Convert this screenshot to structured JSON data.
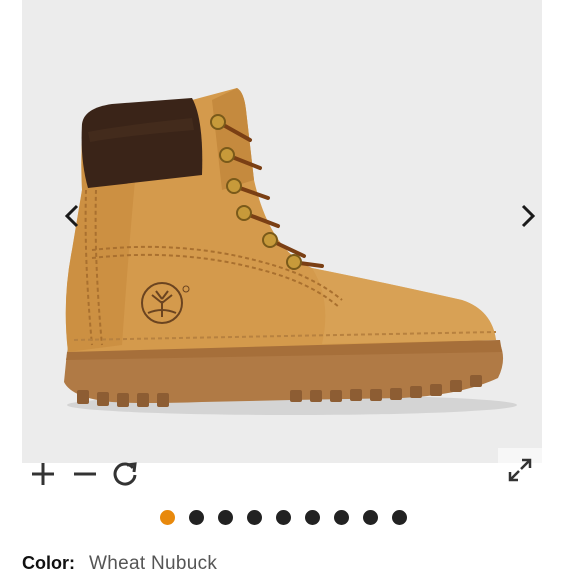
{
  "gallery": {
    "image_alt": "6-Inch Premium waterproof boot in Wheat Nubuck",
    "prev_icon": "chevron-left-icon",
    "next_icon": "chevron-right-icon",
    "active_index": 0,
    "count": 9
  },
  "toolbar": {
    "zoom_in_icon": "plus-icon",
    "zoom_out_icon": "minus-icon",
    "reset_icon": "refresh-icon",
    "fullscreen_icon": "expand-icon"
  },
  "color": {
    "label": "Color:",
    "value": "Wheat Nubuck"
  },
  "colors": {
    "accent_dot": "#e8890c",
    "dot": "#222222",
    "background": "#ececec"
  }
}
